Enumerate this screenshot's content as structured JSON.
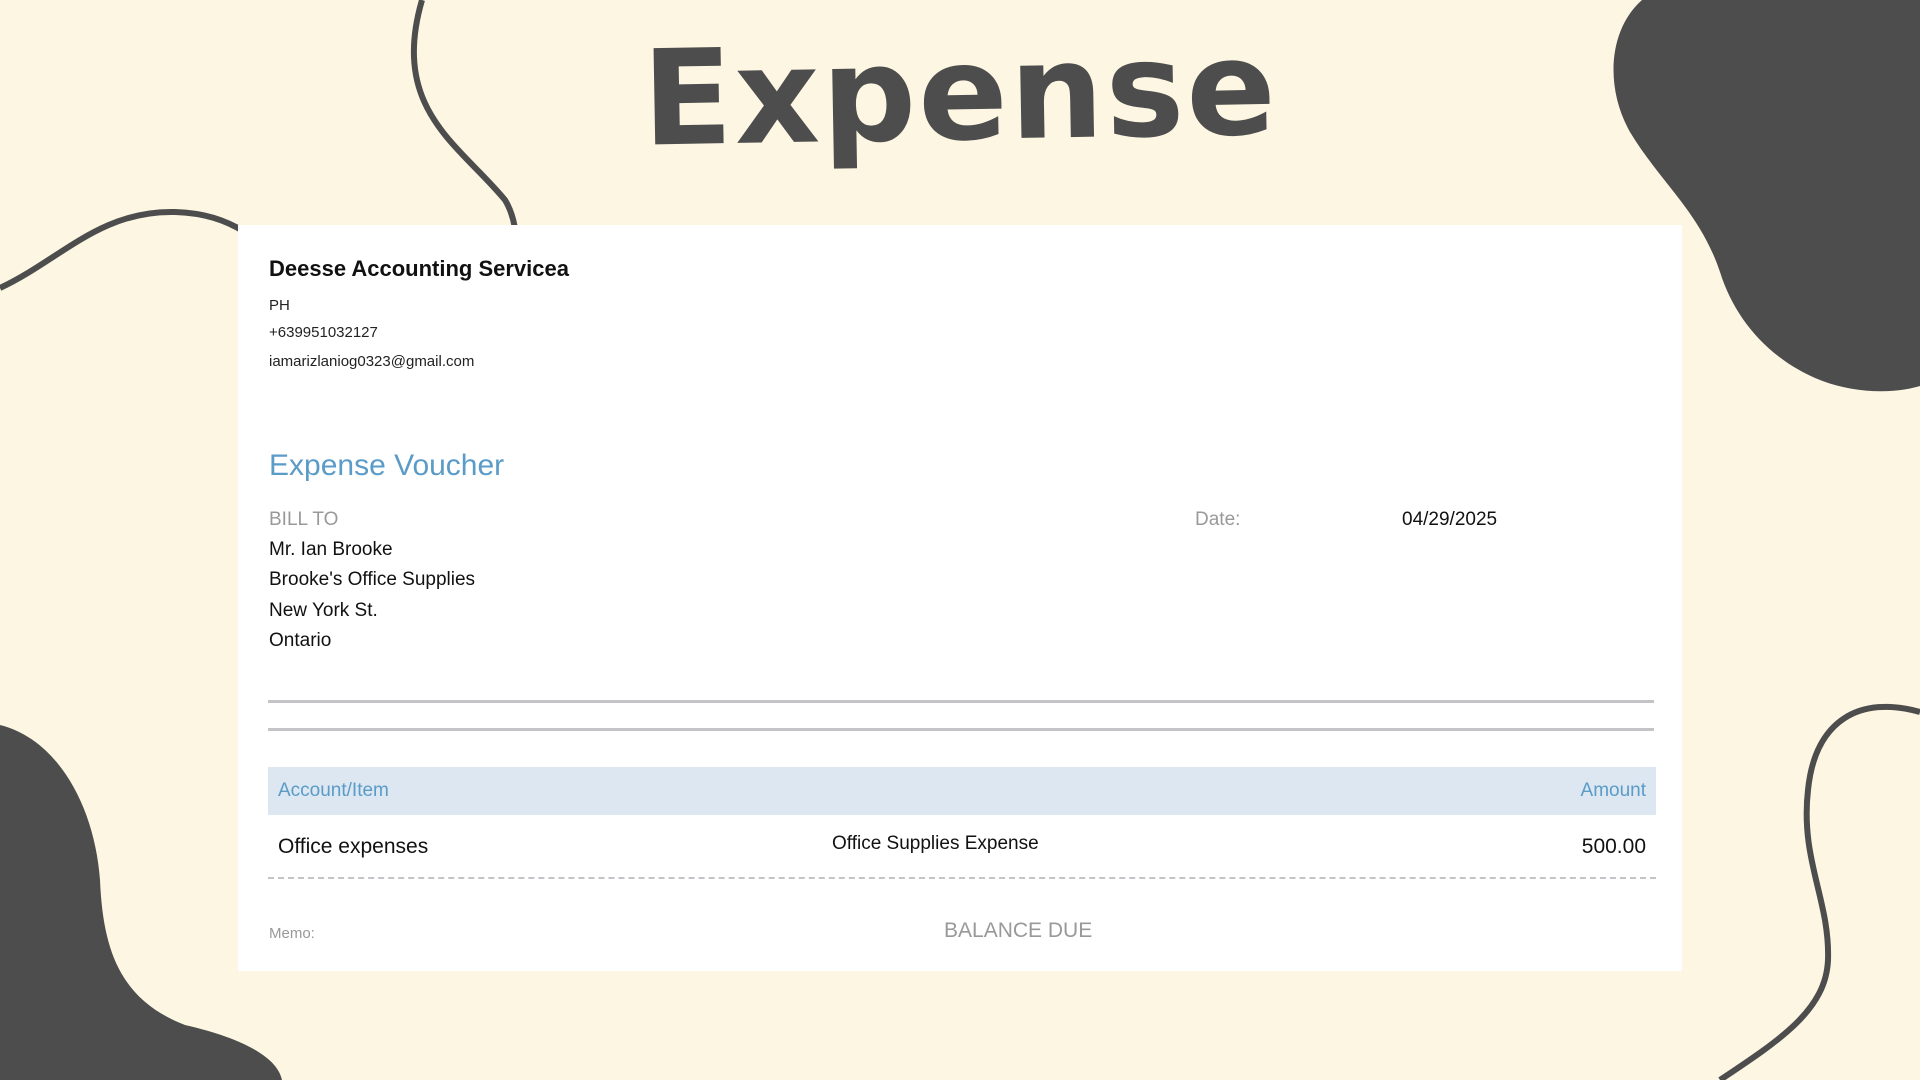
{
  "slide": {
    "title": "Expense"
  },
  "colors": {
    "background": "#fdf6e3",
    "blob": "#4d4d4d",
    "accent": "#5a9bc8",
    "header_fill": "#dce7f1"
  },
  "company": {
    "name": "Deesse Accounting Servicea",
    "country": "PH",
    "phone": "+639951032127",
    "email": "iamarizlaniog0323@gmail.com"
  },
  "voucher": {
    "title": "Expense Voucher",
    "bill_to_label": "BILL TO",
    "bill_to": {
      "name": "Mr. Ian Brooke",
      "company": "Brooke's Office Supplies",
      "street": "New York St.",
      "region": "Ontario"
    },
    "date_label": "Date:",
    "date_value": "04/29/2025"
  },
  "table": {
    "headers": {
      "account": "Account/Item",
      "amount": "Amount"
    },
    "rows": [
      {
        "item": "Office expenses",
        "description": "Office Supplies Expense",
        "amount": "500.00"
      }
    ]
  },
  "footer": {
    "memo_label": "Memo:",
    "balance_label": "BALANCE DUE"
  }
}
